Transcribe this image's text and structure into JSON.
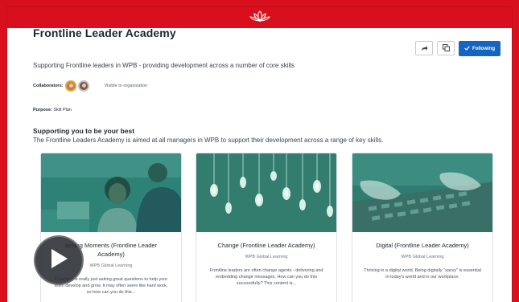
{
  "header": {
    "logo_icon": "lotus-logo-icon",
    "brand_color": "#d8101d"
  },
  "page": {
    "title": "Frontline Leader Academy",
    "subtitle": "Supporting Frontline leaders in WPB - providing development across a number of core skills"
  },
  "actions": {
    "share_icon": "share-arrow-icon",
    "copy_icon": "copy-icon",
    "follow_label": "Following",
    "follow_icon": "checkmark-icon",
    "accent": "#1565c0"
  },
  "collaborators": {
    "label": "Collaborators:",
    "visibility": "Visible to organization"
  },
  "purpose": {
    "label": "Purpose:",
    "value": "Skill Plan"
  },
  "section": {
    "title": "Supporting you to be your best",
    "description": "The Frontline Leaders Academy is aimed at all managers in WPB to support their development across a range of key skills."
  },
  "cards": [
    {
      "title": "Coaching Moments (Frontline Leader Academy)",
      "title_visible": "aching Moments (Frontline Leader Academy)",
      "source": "WPB Global Learning",
      "description": "Coaching is really just asking great questions to help your team develop and grow. It may often seem like hard work, so how can you do this..."
    },
    {
      "title": "Change (Frontline Leader Academy)",
      "source": "WPB Global Learning",
      "description": "Frontline leaders are often change agents - delivering and embedding change messages. How can you do this successfully? This content is..."
    },
    {
      "title": "Digital (Frontline Leader Academy)",
      "source": "WPB Global Learning",
      "description": "Thriving in a digital world. Being digitally \"savvy\" is essential in today's world and in our workplace."
    }
  ],
  "overlay": {
    "play_icon": "play-icon"
  }
}
